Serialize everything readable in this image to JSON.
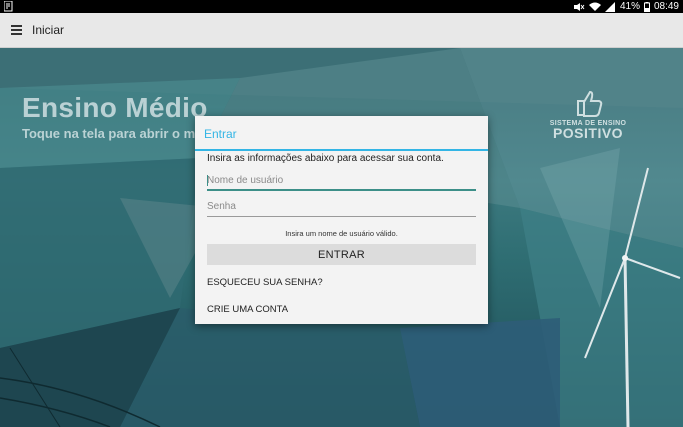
{
  "status_bar": {
    "battery": "41%",
    "time": "08:49"
  },
  "app_bar": {
    "title": "Iniciar",
    "menu_icon": "hamburger-menu-icon"
  },
  "background": {
    "headline": "Ensino Médio",
    "subline": "Toque na tela para abrir o menu Iní",
    "brand_small": "SISTEMA DE ENSINO",
    "brand_big": "POSITIVO"
  },
  "dialog": {
    "title": "Entrar",
    "message": "Insira as informações abaixo para acessar sua conta.",
    "username_placeholder": "Nome de usuário",
    "password_placeholder": "Senha",
    "error": "Insira um nome de usuário válido.",
    "enter_button": "ENTRAR",
    "forgot_link": "ESQUECEU SUA SENHA?",
    "create_link": "CRIE UMA CONTA"
  },
  "colors": {
    "accent": "#33b5e5",
    "field_focus": "#3c8f88"
  }
}
